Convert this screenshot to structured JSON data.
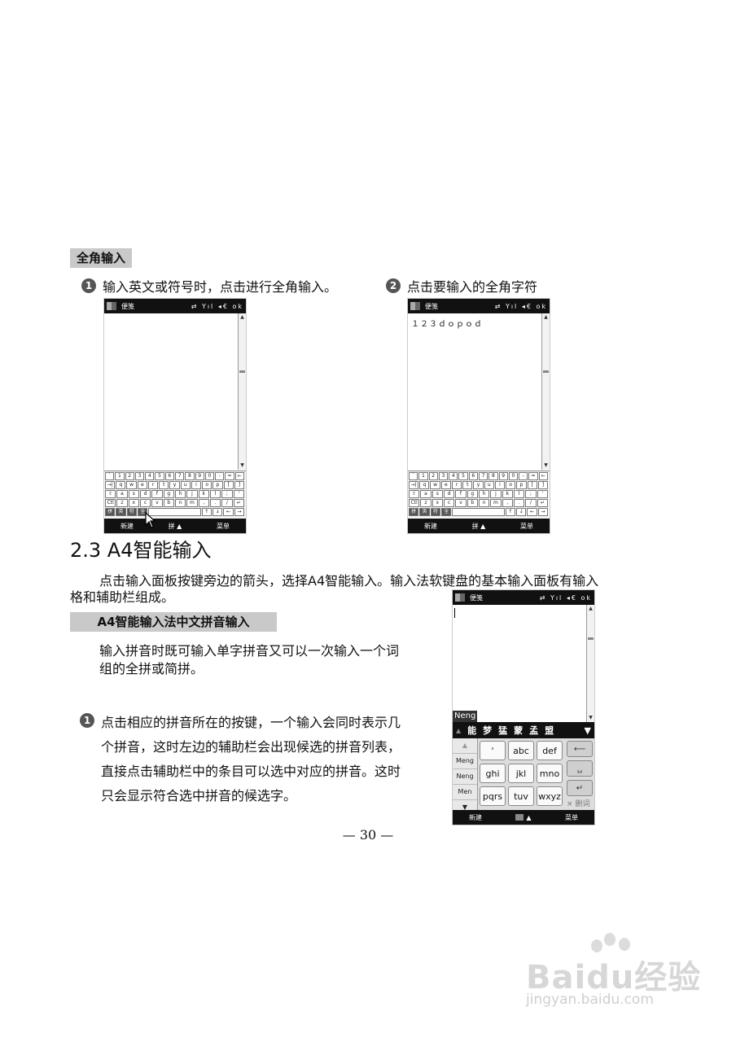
{
  "section1": {
    "label": "全角输入",
    "step1": {
      "num": "1",
      "text": "输入英文或符号时，点击进行全角输入。"
    },
    "step2": {
      "num": "2",
      "text": "点击要输入的全角字符"
    }
  },
  "phone_left": {
    "title": "便笺",
    "sys": "⇄ Yıl ◂€ ok",
    "content": "",
    "bottom": {
      "left": "新建",
      "center": "拼 ▲",
      "right": "菜单"
    }
  },
  "phone_right": {
    "title": "便笺",
    "sys": "⇄ Yıl ◂€ ok",
    "content": "１２３ｄｏｐｏｄ",
    "bottom": {
      "left": "新建",
      "center": "拼 ▲",
      "right": "菜单"
    }
  },
  "keyboard": {
    "row1": [
      "`",
      "1",
      "2",
      "3",
      "4",
      "5",
      "6",
      "7",
      "8",
      "9",
      "0",
      "-",
      "=",
      "←"
    ],
    "row2": [
      "→|",
      "q",
      "w",
      "e",
      "r",
      "t",
      "y",
      "u",
      "i",
      "o",
      "p",
      "[",
      "]"
    ],
    "row3": [
      "⇧",
      "a",
      "s",
      "d",
      "f",
      "g",
      "h",
      "j",
      "k",
      "l",
      ";",
      "'"
    ],
    "row4": [
      "Ctl",
      "z",
      "x",
      "c",
      "v",
      "b",
      "n",
      "m",
      ",",
      ".",
      "/",
      "↵"
    ],
    "row5": [
      "拼",
      "英",
      "符",
      "全",
      "",
      "↑",
      "↓",
      "←",
      "→"
    ]
  },
  "section2": {
    "heading": "2.3  A4智能输入",
    "intro_line1": "点击输入面板按键旁边的箭头，选择A4智能输入。输入法软键盘的基本输入面板有输入",
    "intro_line2": "格和辅助栏组成。",
    "label": "A4智能输入法中文拼音输入",
    "desc_line1": "输入拼音时既可输入单字拼音又可以一次输入一个词",
    "desc_line2": "组的全拼或简拼。",
    "step1": {
      "num": "1",
      "line1": "点击相应的拼音所在的按键，一个输入会同时表示几",
      "line2": "个拼音，这时左边的辅助栏会出现候选的拼音列表，",
      "line3": "直接点击辅助栏中的条目可以选中对应的拼音。这时",
      "line4": "只会显示符合选中拼音的候选字。"
    }
  },
  "phone_a4": {
    "title": "便笺",
    "sys": "⇄ Yıl ◂€ ok",
    "tag": "Neng",
    "candidates": [
      "能",
      "梦",
      "猛",
      "蒙",
      "孟",
      "盟"
    ],
    "side": [
      "▲",
      "Meng",
      "Neng",
      "Men",
      "▼"
    ],
    "keys": [
      "'",
      "abc",
      "def",
      "ghi",
      "jkl",
      "mno",
      "pqrs",
      "tuv",
      "wxyz"
    ],
    "delete": "× 删词",
    "bottom": {
      "left": "新建",
      "center": "▲",
      "right": "菜单"
    }
  },
  "page_number": "— 30 —",
  "watermark": {
    "brand": "Baidu经验",
    "url": "jingyan.baidu.com"
  }
}
